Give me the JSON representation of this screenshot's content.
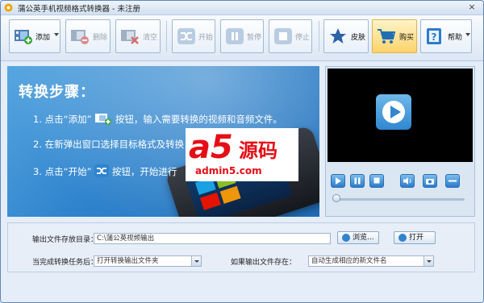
{
  "window": {
    "title": "蒲公英手机视频格式转换器 - 未注册",
    "close_glyph": "×"
  },
  "toolbar": {
    "add": {
      "label": "添加",
      "icon": "add-video-icon"
    },
    "delete": {
      "label": "删除",
      "icon": "delete-video-icon"
    },
    "clear": {
      "label": "清空",
      "icon": "clear-video-icon"
    },
    "start": {
      "label": "开始",
      "icon": "shuffle-icon"
    },
    "pause": {
      "label": "暂停",
      "icon": "pause-icon"
    },
    "stop": {
      "label": "停止",
      "icon": "stop-icon"
    },
    "skin": {
      "label": "皮肤",
      "icon": "star-icon"
    },
    "buy": {
      "label": "购买",
      "icon": "cart-icon"
    },
    "help": {
      "label": "帮助",
      "icon": "help-icon"
    }
  },
  "banner": {
    "title": "转换步骤：",
    "step1_pre": "1. 点击“添加”",
    "step1_post": "按钮，输入需要转换的视频和音频文件。",
    "step2": "2. 在新弹出窗口选择目标格式及转换",
    "step3_pre": "3. 点击“开始”",
    "step3_post": "按钮，开始进行",
    "watermark": {
      "big": "a5",
      "chars": "源码",
      "url": "admin5.com"
    }
  },
  "player": {
    "controls": [
      "play-icon",
      "pause-icon",
      "stop-icon",
      "volume-icon",
      "snapshot-icon",
      "fullscreen-icon"
    ],
    "progress": 0.0
  },
  "settings": {
    "output_dir_label": "输出文件存放目录：",
    "output_dir_value": "C:\\蒲公英视频输出",
    "browse_label": "浏览...",
    "open_label": "打开",
    "after_done_label": "当完成转换任务后：",
    "after_done_value": "打开转换输出文件夹",
    "file_exists_label": "如果输出文件存在：",
    "file_exists_value": "自动生成相应的新文件名"
  },
  "colors": {
    "accent": "#2f84cd",
    "watermark": "#e50e16",
    "highlight": "#fcd36a"
  }
}
